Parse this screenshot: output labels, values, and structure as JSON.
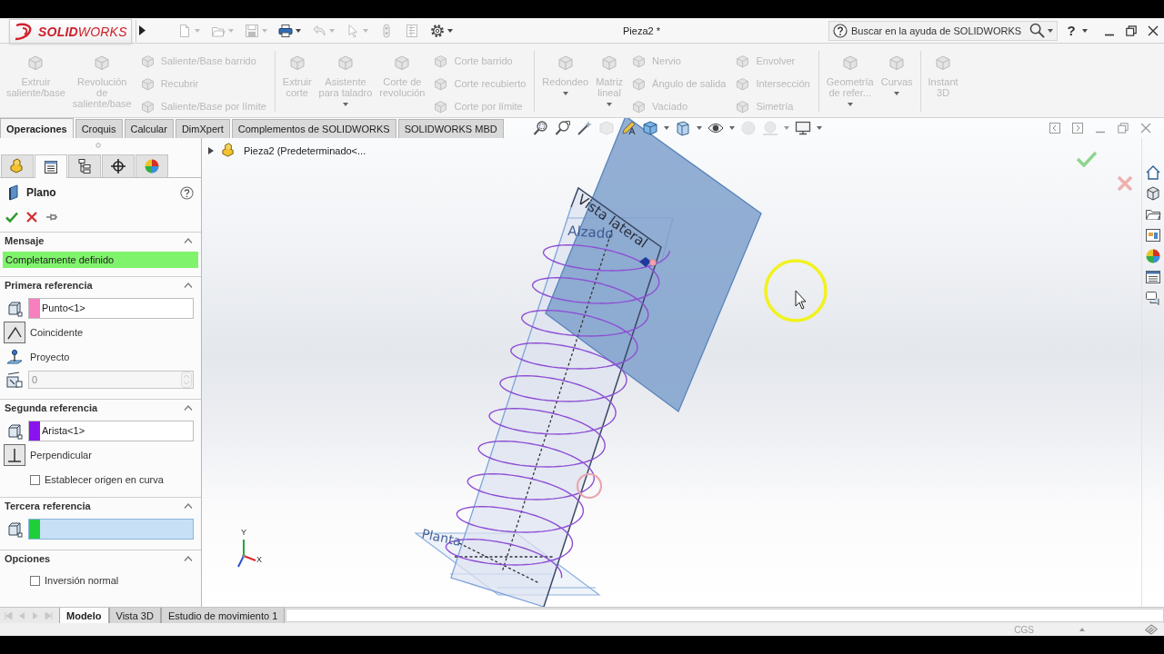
{
  "window": {
    "title": "Pieza2 *"
  },
  "title_bar": {
    "logo": "**SOLID**WORKS",
    "quick_access": [
      {
        "kind": "new",
        "disabled": true,
        "menu": true
      },
      {
        "kind": "open",
        "disabled": true,
        "menu": true
      },
      {
        "kind": "save",
        "disabled": true,
        "menu": true
      },
      {
        "kind": "print",
        "disabled": false,
        "menu": true
      },
      {
        "kind": "undo",
        "disabled": true,
        "menu": true
      },
      {
        "kind": "select",
        "disabled": true,
        "menu": true
      },
      {
        "kind": "rebuild",
        "disabled": true,
        "menu": false
      },
      {
        "kind": "properties",
        "disabled": true,
        "menu": false
      },
      {
        "kind": "options",
        "disabled": false,
        "menu": true
      }
    ],
    "search": {
      "placeholder": "Buscar en la ayuda de SOLIDWORKS"
    },
    "help": "?"
  },
  "ribbon": {
    "groups": [
      {
        "items": [
          {
            "kind": "large",
            "label": "Extruir\nsaliente/base",
            "disabled": true,
            "menu": false
          },
          {
            "kind": "large",
            "label": "Revolución\nde\nsaliente/base",
            "disabled": true,
            "menu": false
          },
          {
            "kind": "stack",
            "commands": [
              {
                "label": "Saliente/Base barrido",
                "disabled": true
              },
              {
                "label": "Recubrir",
                "disabled": true
              },
              {
                "label": "Saliente/Base por límite",
                "disabled": true
              }
            ]
          }
        ]
      },
      {
        "items": [
          {
            "kind": "large",
            "label": "Extruir\ncorte",
            "disabled": true,
            "menu": false
          },
          {
            "kind": "large",
            "label": "Asistente\npara taladro",
            "disabled": true,
            "menu": true
          },
          {
            "kind": "large",
            "label": "Corte de\nrevolución",
            "disabled": true,
            "menu": false
          },
          {
            "kind": "stack",
            "commands": [
              {
                "label": "Corte barrido",
                "disabled": true
              },
              {
                "label": "Corte recubierto",
                "disabled": true
              },
              {
                "label": "Corte por límite",
                "disabled": true
              }
            ]
          }
        ]
      },
      {
        "items": [
          {
            "kind": "large",
            "label": "Redondeo",
            "disabled": true,
            "menu": true
          },
          {
            "kind": "large",
            "label": "Matriz\nlineal",
            "disabled": true,
            "menu": true
          },
          {
            "kind": "stack",
            "commands": [
              {
                "label": "Nervio",
                "disabled": true
              },
              {
                "label": "Ángulo de salida",
                "disabled": true
              },
              {
                "label": "Vaciado",
                "disabled": true
              }
            ]
          },
          {
            "kind": "stack",
            "commands": [
              {
                "label": "Envolver",
                "disabled": true
              },
              {
                "label": "Intersección",
                "disabled": true
              },
              {
                "label": "Simetría",
                "disabled": true
              }
            ]
          }
        ]
      },
      {
        "items": [
          {
            "kind": "large",
            "label": "Geometría\nde refer...",
            "disabled": true,
            "menu": true
          },
          {
            "kind": "large",
            "label": "Curvas",
            "disabled": true,
            "menu": true
          }
        ]
      },
      {
        "items": [
          {
            "kind": "large",
            "label": "Instant\n3D",
            "disabled": true,
            "menu": false
          }
        ]
      }
    ]
  },
  "command_tabs": [
    {
      "label": "Operaciones",
      "selected": true
    },
    {
      "label": "Croquis",
      "selected": false
    },
    {
      "label": "Calcular",
      "selected": false
    },
    {
      "label": "DimXpert",
      "selected": false
    },
    {
      "label": "Complementos de SOLIDWORKS",
      "selected": false
    },
    {
      "label": "SOLIDWORKS MBD",
      "selected": false
    }
  ],
  "panel": {
    "tabs": [
      {
        "kind": "features",
        "selected": false
      },
      {
        "kind": "properties",
        "selected": true
      },
      {
        "kind": "configurations",
        "selected": false
      },
      {
        "kind": "dimxpert",
        "selected": false
      },
      {
        "kind": "display",
        "selected": false
      }
    ],
    "title": "Plano",
    "sections": [
      {
        "kind": "message",
        "title": "Mensaje",
        "expanded": true,
        "message": "Completamente definido"
      },
      {
        "kind": "reference",
        "title": "Primera referencia",
        "expanded": true,
        "selection": {
          "value": "Punto<1>",
          "color": "#f77fbe",
          "active": false
        },
        "constraints": [
          {
            "kind": "coincident",
            "label": "Coincidente",
            "selected": true
          },
          {
            "kind": "project",
            "label": "Proyecto",
            "selected": false
          }
        ],
        "distance": {
          "value": "0",
          "disabled": true
        }
      },
      {
        "kind": "reference",
        "title": "Segunda referencia",
        "expanded": true,
        "selection": {
          "value": "Arista<1>",
          "color": "#8a14f0",
          "active": false
        },
        "constraints": [
          {
            "kind": "perpendicular",
            "label": "Perpendicular",
            "selected": true
          }
        ],
        "checkboxes": [
          {
            "label": "Establecer origen en curva",
            "checked": false
          }
        ]
      },
      {
        "kind": "reference",
        "title": "Tercera referencia",
        "expanded": true,
        "selection": {
          "color": "#1fcf3a",
          "active": true
        }
      },
      {
        "kind": "options",
        "title": "Opciones",
        "expanded": true,
        "checkboxes": [
          {
            "label": "Inversión normal",
            "checked": false
          }
        ]
      }
    ]
  },
  "viewport": {
    "tree_item": "Pieza2 (Predeterminado<...",
    "planes": [
      {
        "label": "Vista lateral",
        "highlighted": true
      },
      {
        "label": "Alzado",
        "highlighted": false
      },
      {
        "label": "Planta",
        "highlighted": false
      }
    ],
    "triad": [
      {
        "label": "Y"
      },
      {
        "label": "X"
      }
    ]
  },
  "bottom_tabs": [
    {
      "label": "Modelo",
      "selected": true
    },
    {
      "label": "Vista 3D",
      "selected": false
    },
    {
      "label": "Estudio de movimiento 1",
      "selected": false
    }
  ],
  "status_bar": {
    "units": "CGS"
  }
}
